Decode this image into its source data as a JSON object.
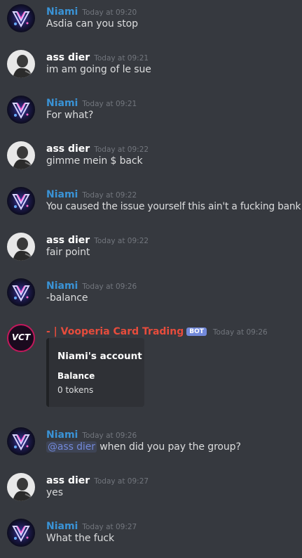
{
  "colors": {
    "background": "#36393f",
    "niami": "#3a93d6",
    "ass_dier": "#ffffff",
    "bot_name": "#e74c3c",
    "timestamp": "#72767d",
    "text": "#dcddde",
    "mention": "#7289da",
    "bot_tag": "#7289da"
  },
  "messages": [
    {
      "author": "Niami",
      "time": "Today at 09:20",
      "text": "Asdia can you stop"
    },
    {
      "author": "ass dier",
      "time": "Today at 09:21",
      "text": "im am going of le sue"
    },
    {
      "author": "Niami",
      "time": "Today at 09:21",
      "text": "For what?"
    },
    {
      "author": "ass dier",
      "time": "Today at 09:22",
      "text": "gimme mein $ back"
    },
    {
      "author": "Niami",
      "time": "Today at 09:22",
      "text": "You caused the issue yourself this ain't a fucking bank"
    },
    {
      "author": "ass dier",
      "time": "Today at 09:22",
      "text": "fair point"
    },
    {
      "author": "Niami",
      "time": "Today at 09:26",
      "text": "-balance"
    },
    {
      "author": "- | Vooperia Card Trading",
      "bot_tag": "BOT",
      "avatar_text": "VCT",
      "time": "Today at 09:26",
      "embed": {
        "title": "Niami's account",
        "field_name": "Balance",
        "field_value": "0 tokens"
      }
    },
    {
      "author": "Niami",
      "time": "Today at 09:26",
      "mention": "@ass dier",
      "text": " when did you pay the group?"
    },
    {
      "author": "ass dier",
      "time": "Today at 09:27",
      "text": "yes"
    },
    {
      "author": "Niami",
      "time": "Today at 09:27",
      "text": "What the fuck"
    }
  ]
}
